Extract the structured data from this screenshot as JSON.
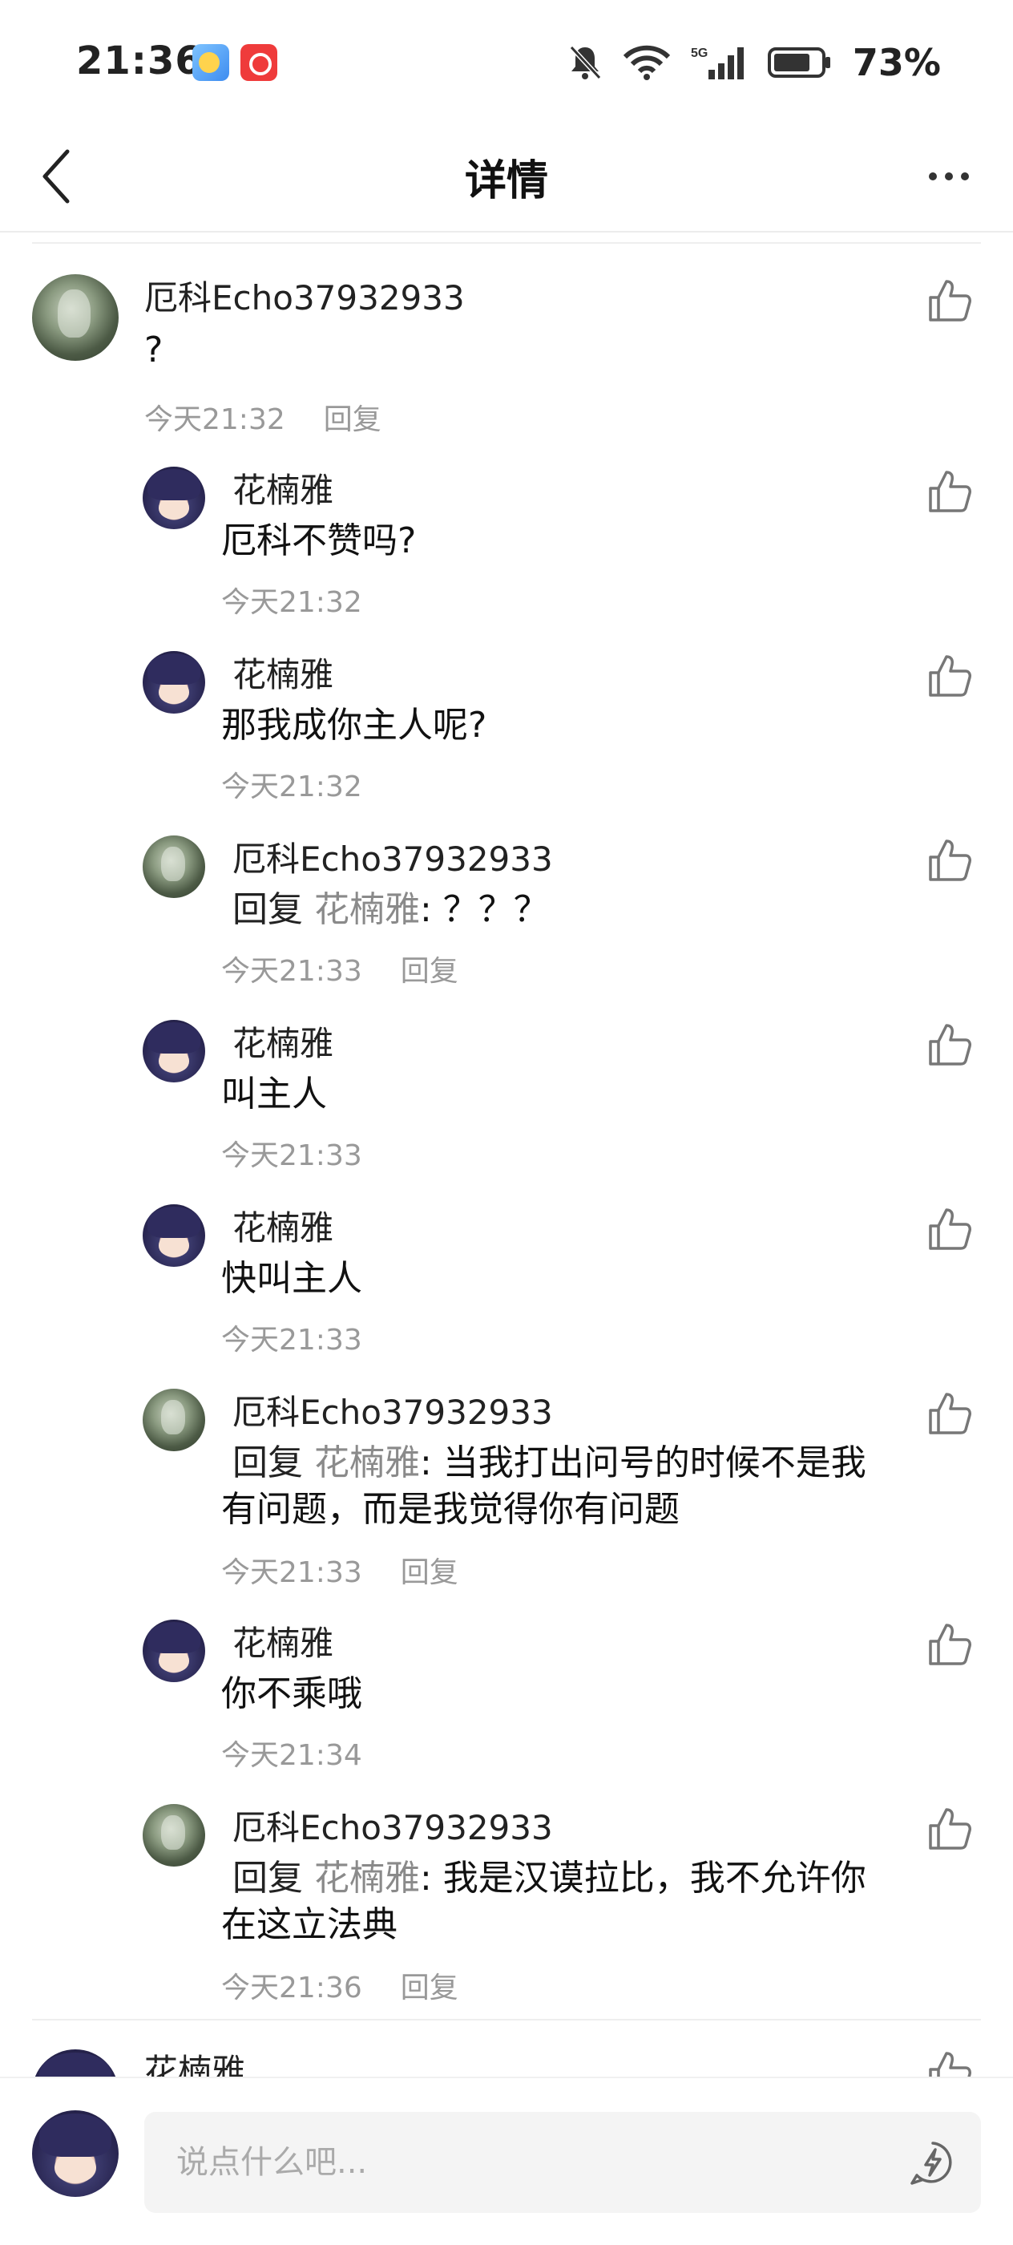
{
  "status_bar": {
    "time": "21:36",
    "network": "5G",
    "battery": "73%"
  },
  "nav": {
    "title": "详情"
  },
  "main_comment": {
    "author": "厄科Echo37932933",
    "text": "?",
    "time": "今天21:32",
    "reply_label": "回复"
  },
  "replies": [
    {
      "author": "花楠雅",
      "text": "厄科不赞吗?",
      "time": "今天21:32"
    },
    {
      "author": "花楠雅",
      "text": "那我成你主人呢?",
      "time": "今天21:32"
    },
    {
      "author": "厄科Echo37932933",
      "reply_kw": "回复",
      "reply_to": "花楠雅",
      "text": ": ？？？",
      "time": "今天21:33",
      "reply_label": "回复"
    },
    {
      "author": "花楠雅",
      "text": "叫主人",
      "time": "今天21:33"
    },
    {
      "author": "花楠雅",
      "text": "快叫主人",
      "time": "今天21:33"
    },
    {
      "author": "厄科Echo37932933",
      "reply_kw": "回复",
      "reply_to": "花楠雅",
      "text": ": 当我打出问号的时候不是我有问题，而是我觉得你有问题",
      "time": "今天21:33",
      "reply_label": "回复"
    },
    {
      "author": "花楠雅",
      "text": "你不乘哦",
      "time": "今天21:34"
    },
    {
      "author": "厄科Echo37932933",
      "reply_kw": "回复",
      "reply_to": "花楠雅",
      "text": ": 我是汉谟拉比，我不允许你在这立法典",
      "time": "今天21:36",
      "reply_label": "回复"
    }
  ],
  "next_comment": {
    "author": "花楠雅"
  },
  "bottom_bar": {
    "placeholder": "说点什么吧..."
  },
  "icons": {
    "back": "chevron-left-icon",
    "more": "more-dots-icon",
    "like": "thumbs-up-icon",
    "emoji": "emoji-lightning-icon"
  }
}
